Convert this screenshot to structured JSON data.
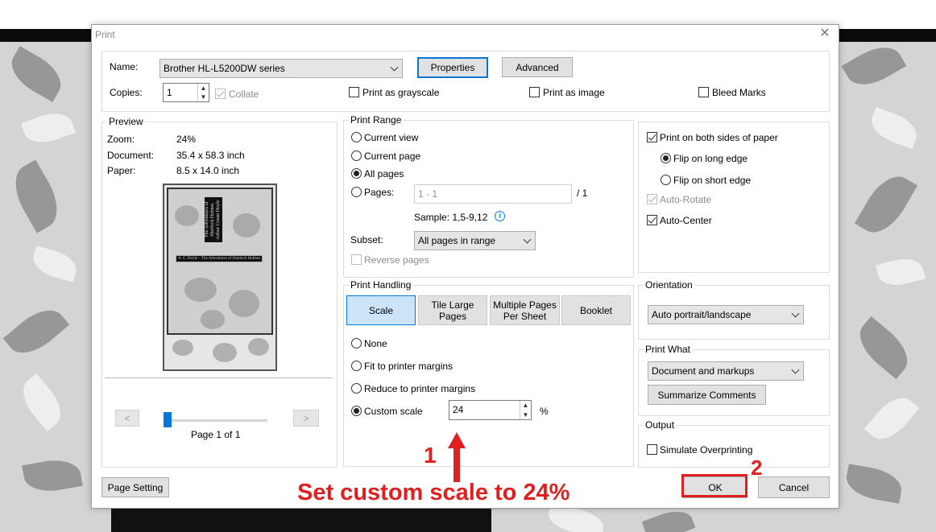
{
  "window": {
    "title": "Print",
    "close_glyph": "✕"
  },
  "printer": {
    "name_label": "Name:",
    "name_value": "Brother HL-L5200DW series",
    "properties_label": "Properties",
    "advanced_label": "Advanced",
    "copies_label": "Copies:",
    "copies_value": "1",
    "collate_label": "Collate",
    "grayscale_label": "Print as grayscale",
    "as_image_label": "Print as image",
    "bleed_label": "Bleed Marks"
  },
  "preview": {
    "group_title": "Preview",
    "zoom_label": "Zoom:",
    "zoom_value": "24%",
    "document_label": "Document:",
    "document_value": "35.4 x 58.3 inch",
    "paper_label": "Paper:",
    "paper_value": "8.5 x 14.0 inch",
    "thumb_title": "The Adventures of Sherlock Holmes",
    "thumb_subtitle": "Arthur Conan Doyle",
    "thumb_banner": "A. C. Doyle – The Adventures of Sherlock Holmes",
    "prev_label": "<",
    "next_label": ">",
    "page_indicator": "Page 1 of 1",
    "slider_position": 0
  },
  "print_range": {
    "group_title": "Print Range",
    "options": [
      "Current view",
      "Current page",
      "All pages",
      "Pages:"
    ],
    "selected": "All pages",
    "pages_value": "1 - 1",
    "pages_total": "/ 1",
    "sample": "Sample: 1,5-9,12",
    "info_icon": "i",
    "subset_label": "Subset:",
    "subset_value": "All pages in range",
    "reverse_label": "Reverse pages"
  },
  "print_handling": {
    "group_title": "Print Handling",
    "tabs": [
      "Scale",
      "Tile Large Pages",
      "Multiple Pages Per Sheet",
      "Booklet"
    ],
    "selected_tab": "Scale",
    "scale_options": [
      "None",
      "Fit to printer margins",
      "Reduce to printer margins",
      "Custom scale"
    ],
    "selected_scale": "Custom scale",
    "custom_scale_value": "24",
    "percent": "%"
  },
  "duplex": {
    "both_sides_label": "Print on both sides of paper",
    "flip_long_label": "Flip on long edge",
    "flip_short_label": "Flip on short edge",
    "auto_rotate_label": "Auto-Rotate",
    "auto_center_label": "Auto-Center"
  },
  "orientation": {
    "group_title": "Orientation",
    "value": "Auto portrait/landscape"
  },
  "print_what": {
    "group_title": "Print What",
    "value": "Document and markups",
    "summarize_label": "Summarize Comments"
  },
  "output": {
    "group_title": "Output",
    "simulate_label": "Simulate Overprinting"
  },
  "footer": {
    "page_setting_label": "Page Setting",
    "ok_label": "OK",
    "cancel_label": "Cancel"
  },
  "annotations": {
    "step1": "1",
    "step2": "2",
    "caption": "Set custom scale to 24%",
    "color": "#e02020"
  },
  "colors": {
    "accent": "#0078d7",
    "selected_tab": "#cce4f7",
    "button": "#e1e1e1"
  }
}
